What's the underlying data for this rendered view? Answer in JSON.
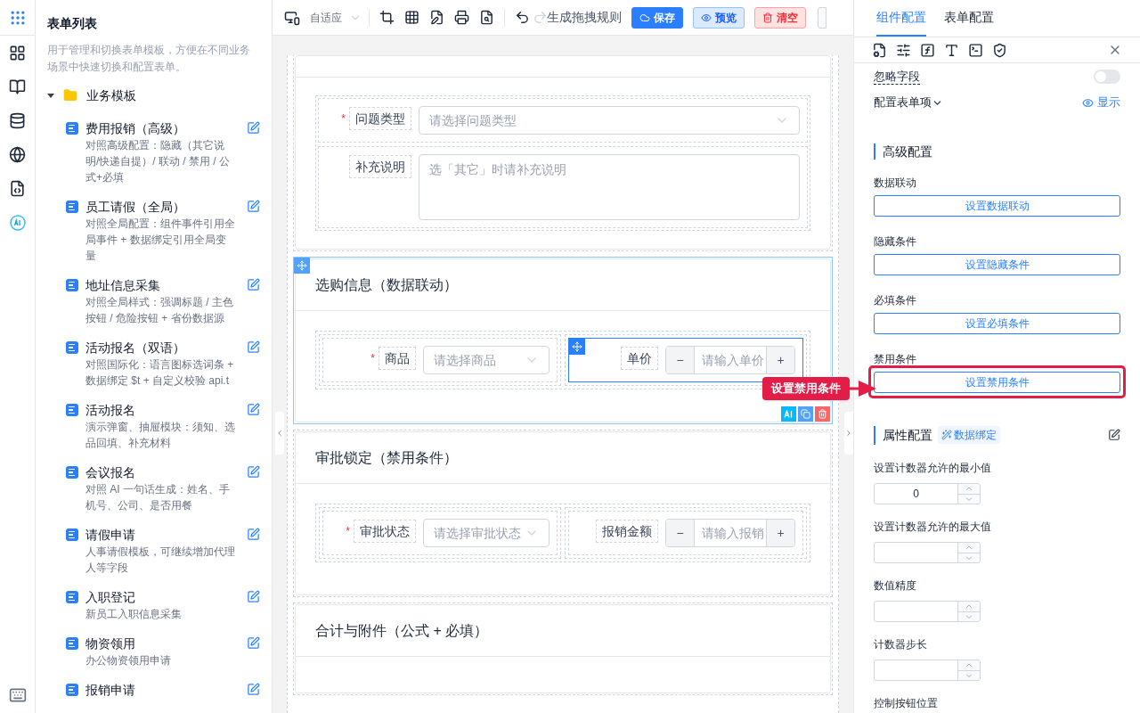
{
  "sidebar": {
    "title": "表单列表",
    "description": "用于管理和切换表单模板，方便在不同业务场景中快速切换和配置表单。",
    "folder": {
      "label": "业务模板",
      "expanded": true,
      "children": [
        {
          "title": "费用报销（高级）",
          "description": "对照高级配置：隐藏（其它说明/快递自提）/ 联动 / 禁用 / 公式+必填"
        },
        {
          "title": "员工请假（全局）",
          "description": "对照全局配置：组件事件引用全局事件 + 数据绑定引用全局变量"
        },
        {
          "title": "地址信息采集",
          "description": "对照全局样式：强调标题 / 主色按钮 / 危险按钮 + 省份数据源"
        },
        {
          "title": "活动报名（双语）",
          "description": "对照国际化：语言图标选词条 + 数据绑定 $t + 自定义校验 api.t"
        },
        {
          "title": "活动报名",
          "description": "演示弹窗、抽屉模块：须知、选品回填、补充材料"
        },
        {
          "title": "会议报名",
          "description": "对照 AI 一句话生成：姓名、手机号、公司、是否用餐"
        },
        {
          "title": "请假申请",
          "description": "人事请假模板，可继续增加代理人等字段"
        },
        {
          "title": "入职登记",
          "description": "新员工入职信息采集"
        },
        {
          "title": "物资领用",
          "description": "办公物资领用申请"
        },
        {
          "title": "报销申请"
        }
      ]
    }
  },
  "toolbar": {
    "device": "自适应",
    "redo_disabled": true,
    "rule_button": "生成拖拽规则",
    "actions": [
      {
        "kind": "primary",
        "label": "保存"
      },
      {
        "kind": "secondary",
        "label": "预览"
      },
      {
        "kind": "danger",
        "label": "清空"
      }
    ]
  },
  "canvas": {
    "required_mark": "*",
    "sections": [
      {
        "selected": false,
        "kind": "stacked",
        "fields": [
          {
            "kind": "select",
            "label": "问题类型",
            "required": true,
            "placeholder": "请选择问题类型",
            "selected": false
          },
          {
            "kind": "textarea",
            "label": "补充说明",
            "required": false,
            "placeholder": "选「其它」时请补充说明",
            "selected": false
          }
        ]
      },
      {
        "title": "选购信息（数据联动）",
        "selected": true,
        "kind": "pair",
        "fields": [
          {
            "kind": "select",
            "label": "商品",
            "required": true,
            "placeholder": "请选择商品",
            "selected": false
          },
          {
            "kind": "number",
            "label": "单价",
            "required": false,
            "placeholder": "请输入单价",
            "selected": true,
            "minus": "−",
            "plus": "+"
          }
        ]
      },
      {
        "title": "审批锁定（禁用条件）",
        "selected": false,
        "kind": "pair",
        "fields": [
          {
            "kind": "select",
            "label": "审批状态",
            "required": true,
            "placeholder": "请选择审批状态",
            "selected": false
          },
          {
            "kind": "number",
            "label": "报销金额",
            "required": false,
            "placeholder": "请输入报销",
            "selected": false,
            "minus": "−",
            "plus": "+"
          }
        ]
      },
      {
        "title": "合计与附件（公式 + 必填）",
        "selected": false,
        "kind": "header"
      }
    ],
    "callout": "设置禁用条件"
  },
  "panel": {
    "tabs": [
      {
        "label": "组件配置",
        "selected": true
      },
      {
        "label": "表单配置",
        "selected": false
      }
    ],
    "ignore_field": {
      "label": "忽略字段",
      "on": false
    },
    "form_item": {
      "label": "配置表单项",
      "visibility": "显示"
    },
    "advanced": {
      "title": "高级配置",
      "items": [
        {
          "label": "数据联动",
          "button": "设置数据联动",
          "highlighted": false
        },
        {
          "label": "隐藏条件",
          "button": "设置隐藏条件",
          "highlighted": false
        },
        {
          "label": "必填条件",
          "button": "设置必填条件",
          "highlighted": false
        },
        {
          "label": "禁用条件",
          "button": "设置禁用条件",
          "highlighted": true
        }
      ]
    },
    "properties": {
      "title": "属性配置",
      "tag": "数据绑定",
      "fields": [
        {
          "kind": "number",
          "label": "设置计数器允许的最小值",
          "value": "0"
        },
        {
          "kind": "number",
          "label": "设置计数器允许的最大值"
        },
        {
          "kind": "number",
          "label": "数值精度"
        },
        {
          "kind": "number",
          "label": "计数器步长"
        },
        {
          "kind": "label",
          "label": "控制按钮位置"
        }
      ]
    }
  }
}
